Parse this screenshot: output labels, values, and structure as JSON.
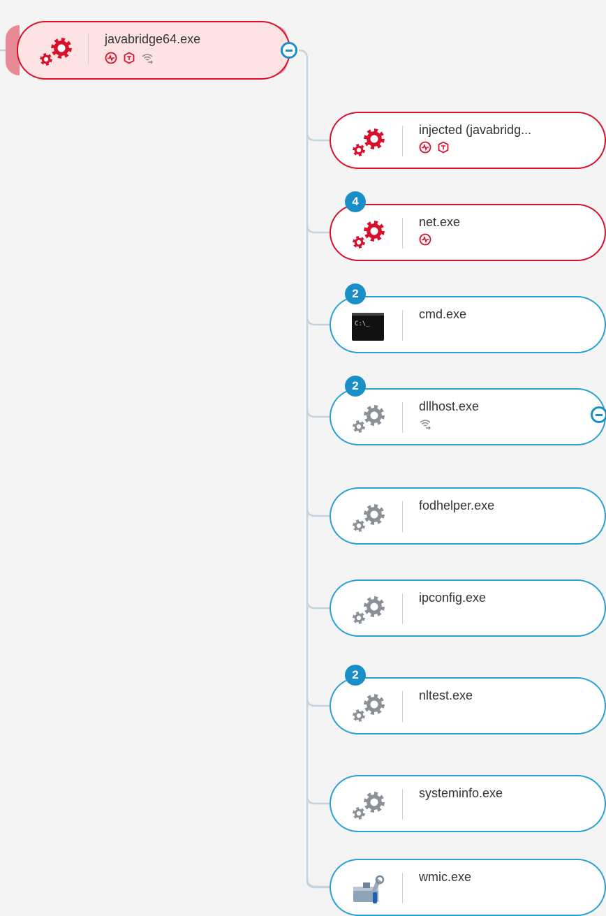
{
  "root": {
    "name": "javabridge64.exe",
    "icon": "gears-red-icon",
    "indicators": [
      "activity-icon",
      "shield-icon",
      "network-icon"
    ]
  },
  "children": [
    {
      "name": "injected (javabridg...",
      "icon": "gears-red-icon",
      "badge": null,
      "indicators": [
        "activity-icon",
        "shield-icon"
      ],
      "alert": true
    },
    {
      "name": "net.exe",
      "icon": "gears-red-icon",
      "badge": "4",
      "indicators": [
        "activity-icon"
      ],
      "alert": true
    },
    {
      "name": "cmd.exe",
      "icon": "terminal-icon",
      "badge": "2",
      "indicators": [],
      "alert": false
    },
    {
      "name": "dllhost.exe",
      "icon": "gears-gray-icon",
      "badge": "2",
      "indicators": [
        "network-icon"
      ],
      "alert": false
    },
    {
      "name": "fodhelper.exe",
      "icon": "gears-gray-icon",
      "badge": null,
      "indicators": [],
      "alert": false
    },
    {
      "name": "ipconfig.exe",
      "icon": "gears-gray-icon",
      "badge": null,
      "indicators": [],
      "alert": false
    },
    {
      "name": "nltest.exe",
      "icon": "gears-gray-icon",
      "badge": "2",
      "indicators": [],
      "alert": false
    },
    {
      "name": "systeminfo.exe",
      "icon": "gears-gray-icon",
      "badge": null,
      "indicators": [],
      "alert": false
    },
    {
      "name": "wmic.exe",
      "icon": "wmic-tool-icon",
      "badge": null,
      "indicators": [],
      "alert": false
    }
  ],
  "colors": {
    "alert": "#d8102b",
    "normal": "#2aa0d3",
    "badge": "#1a8fc7",
    "root_fill": "#fde3e3",
    "connector": "#c5d3dc"
  }
}
